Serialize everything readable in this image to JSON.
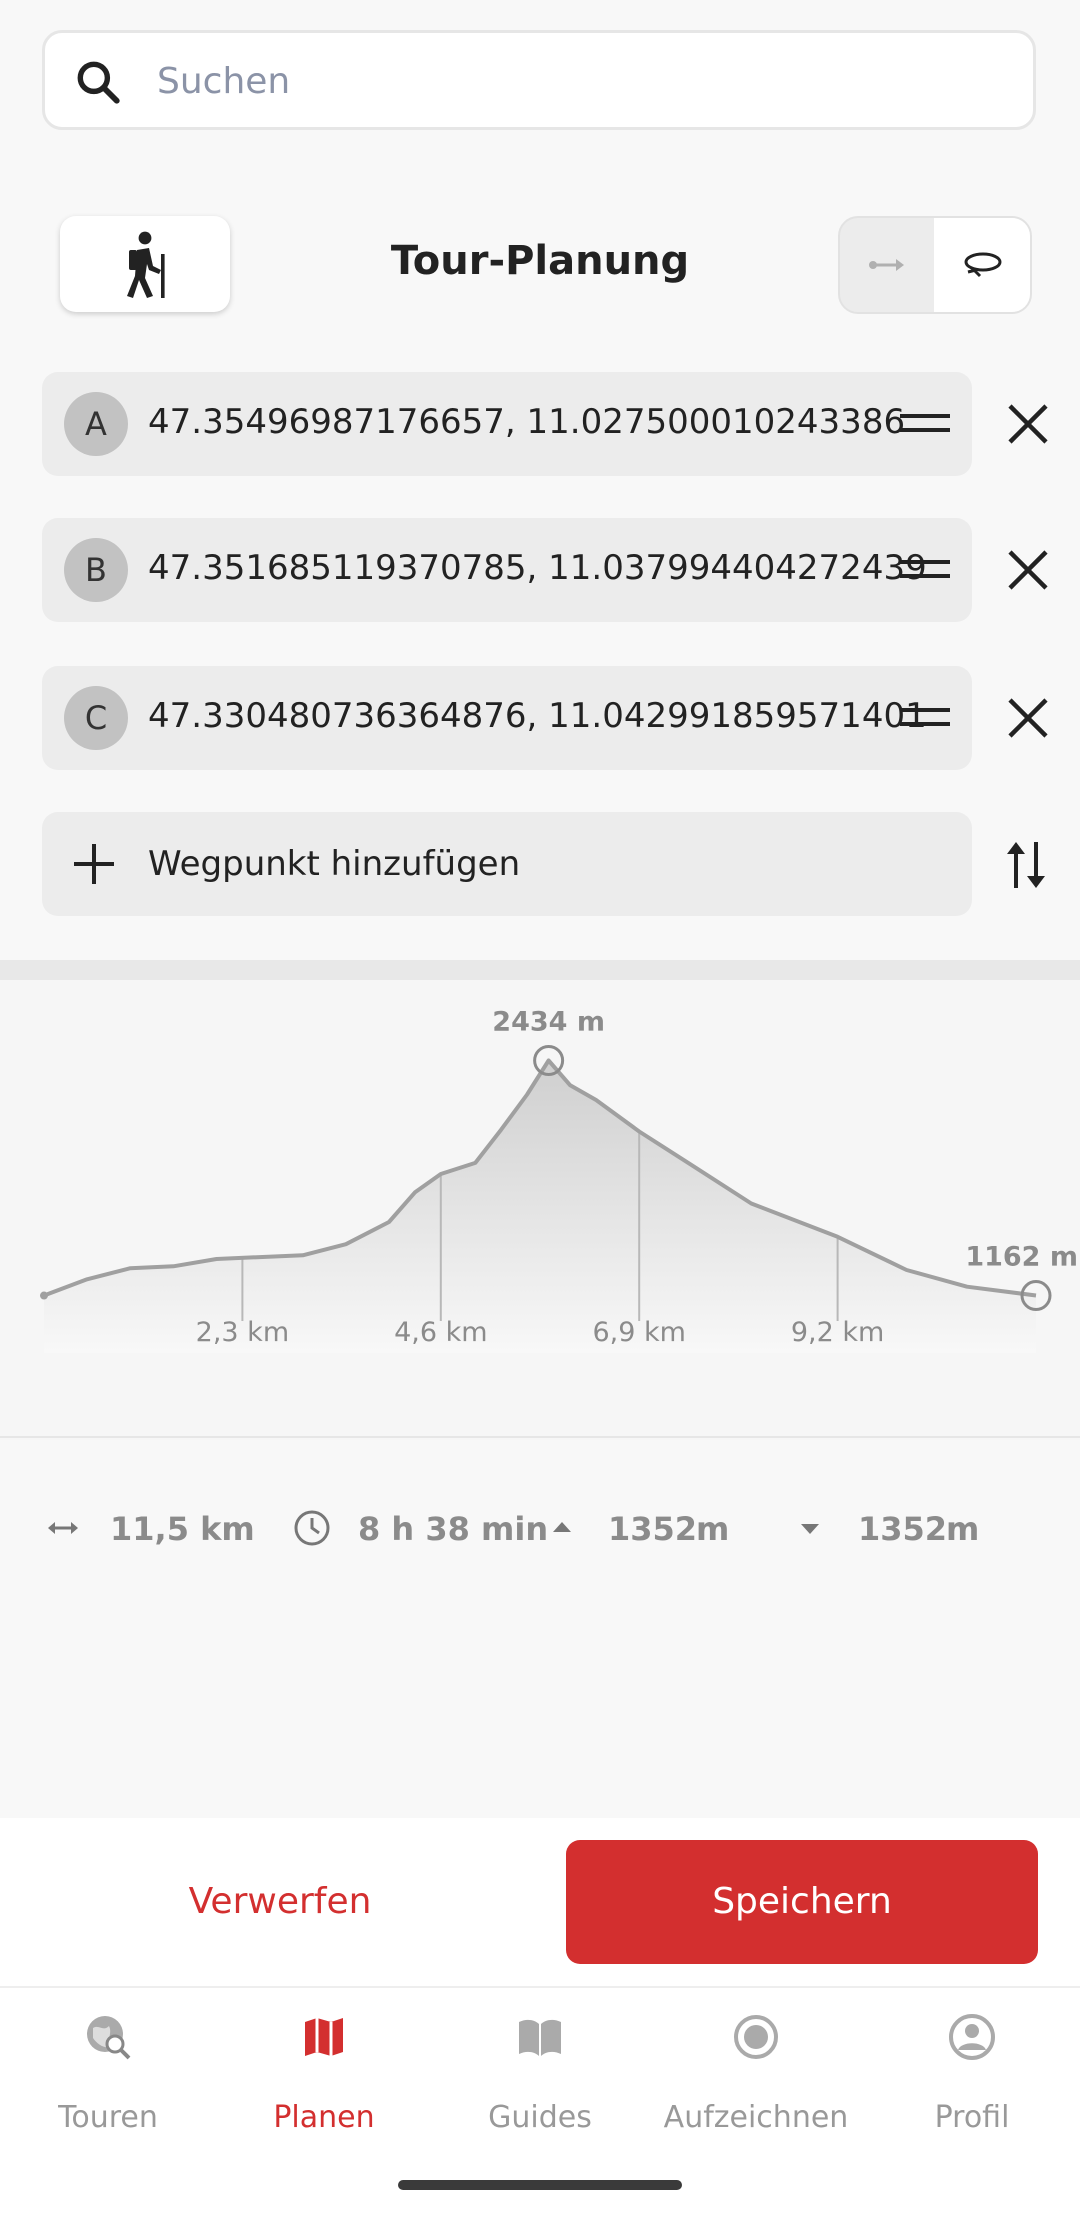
{
  "search": {
    "placeholder": "Suchen",
    "icon": "search-icon"
  },
  "header": {
    "title": "Tour-Planung",
    "mode_icon": "hiker-icon"
  },
  "waypoints": [
    {
      "letter": "A",
      "coords": "47.35496987176657, 11.027500010243386"
    },
    {
      "letter": "B",
      "coords": "47.351685119370785, 11.037994404272439"
    },
    {
      "letter": "C",
      "coords": "47.330480736364876, 11.042991859571401"
    }
  ],
  "add_waypoint": {
    "label": "Wegpunkt hinzufügen"
  },
  "chart_data": {
    "type": "area",
    "x_unit": "km",
    "y_unit": "m",
    "x": [
      0,
      0.5,
      1.0,
      1.5,
      2.0,
      2.5,
      3.0,
      3.5,
      4.0,
      4.3,
      4.6,
      5.0,
      5.3,
      5.6,
      5.85,
      6.1,
      6.4,
      6.9,
      7.5,
      8.2,
      9.2,
      10.0,
      10.7,
      11.5
    ],
    "y": [
      1162,
      1250,
      1310,
      1320,
      1360,
      1370,
      1380,
      1440,
      1560,
      1720,
      1820,
      1880,
      2060,
      2250,
      2434,
      2300,
      2220,
      2050,
      1870,
      1660,
      1480,
      1300,
      1210,
      1162
    ],
    "xticks": [
      2.3,
      4.6,
      6.9,
      9.2
    ],
    "xtick_labels": [
      "2,3 km",
      "4,6 km",
      "6,9 km",
      "9,2 km"
    ],
    "max_label": "2434 m",
    "end_label": "1162 m",
    "xlim": [
      0,
      11.5
    ],
    "ylim": [
      1100,
      2480
    ]
  },
  "stats": {
    "distance": "11,5 km",
    "duration": "8 h 38 min",
    "ascent": "1352",
    "ascent_unit": "m",
    "descent": "1352",
    "descent_unit": "m"
  },
  "buttons": {
    "discard": "Verwerfen",
    "save": "Speichern"
  },
  "nav": [
    {
      "label": "Touren",
      "icon": "globe-search-icon"
    },
    {
      "label": "Planen",
      "icon": "map-icon",
      "active": true
    },
    {
      "label": "Guides",
      "icon": "book-icon"
    },
    {
      "label": "Aufzeichnen",
      "icon": "record-icon"
    },
    {
      "label": "Profil",
      "icon": "profile-icon"
    }
  ],
  "colors": {
    "accent": "#d32f2f",
    "inactive": "#999999"
  }
}
